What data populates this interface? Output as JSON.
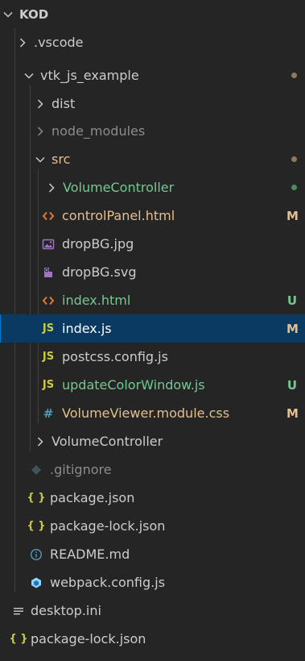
{
  "explorer": {
    "root": {
      "label": "KOD"
    },
    "items": [
      {
        "label": ".vscode"
      },
      {
        "label": "vtk_js_example"
      },
      {
        "label": "dist"
      },
      {
        "label": "node_modules"
      },
      {
        "label": "src"
      },
      {
        "label": "VolumeController"
      },
      {
        "label": "controlPanel.html",
        "badge": "M"
      },
      {
        "label": "dropBG.jpg"
      },
      {
        "label": "dropBG.svg"
      },
      {
        "label": "index.html",
        "badge": "U"
      },
      {
        "label": "index.js",
        "badge": "M"
      },
      {
        "label": "postcss.config.js"
      },
      {
        "label": "updateColorWindow.js",
        "badge": "U"
      },
      {
        "label": "VolumeViewer.module.css",
        "badge": "M"
      },
      {
        "label": "VolumeController"
      },
      {
        "label": ".gitignore"
      },
      {
        "label": "package.json"
      },
      {
        "label": "package-lock.json"
      },
      {
        "label": "README.md"
      },
      {
        "label": "webpack.config.js"
      },
      {
        "label": "desktop.ini"
      },
      {
        "label": "package-lock.json"
      }
    ],
    "icon_labels": {
      "js": "JS",
      "css": "#",
      "json": "{ }"
    },
    "colors": {
      "background": "#252526",
      "selection": "#0a3a61",
      "text": "#cccccc",
      "untracked": "#73c991",
      "modified": "#e2c08d",
      "html_icon": "#e37933",
      "js_icon": "#cbcb41",
      "css_icon": "#519aba",
      "json_icon": "#cbcb41"
    }
  }
}
